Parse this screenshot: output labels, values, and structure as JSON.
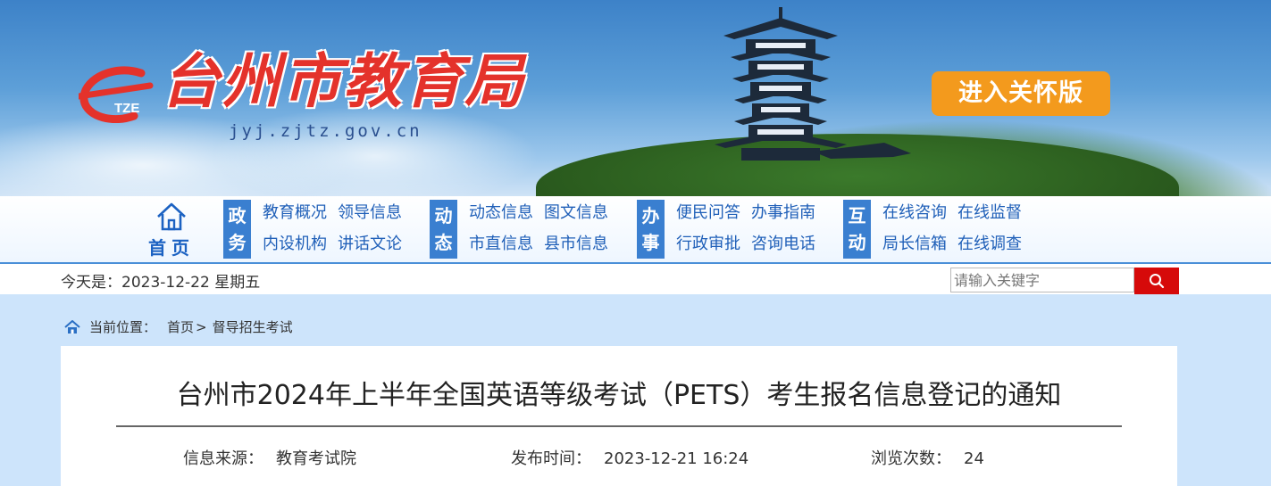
{
  "header": {
    "logo_text": "台州市教育局",
    "logo_mark": "TZE",
    "url": "jyj.zjtz.gov.cn",
    "care_button": "进入关怀版"
  },
  "nav": {
    "home_label": "首页",
    "groups": [
      {
        "category": [
          "政",
          "务"
        ],
        "links": [
          "教育概况",
          "领导信息",
          "内设机构",
          "讲话文论"
        ]
      },
      {
        "category": [
          "动",
          "态"
        ],
        "links": [
          "动态信息",
          "图文信息",
          "市直信息",
          "县市信息"
        ]
      },
      {
        "category": [
          "办",
          "事"
        ],
        "links": [
          "便民问答",
          "办事指南",
          "行政审批",
          "咨询电话"
        ]
      },
      {
        "category": [
          "互",
          "动"
        ],
        "links": [
          "在线咨询",
          "在线监督",
          "局长信箱",
          "在线调查"
        ]
      }
    ]
  },
  "datebar": {
    "date_text": "今天是：2023-12-22 星期五",
    "search_placeholder": "请输入关键字"
  },
  "breadcrumb": {
    "label": "当前位置：",
    "home": "首页",
    "sep": ">",
    "current": "督导招生考试"
  },
  "article": {
    "title": "台州市2024年上半年全国英语等级考试（PETS）考生报名信息登记的通知",
    "source_label": "信息来源：",
    "source_value": "教育考试院",
    "time_label": "发布时间：",
    "time_value": "2023-12-21 16:24",
    "views_label": "浏览次数：",
    "views_value": "24"
  },
  "colors": {
    "nav_blue": "#3a7fd0",
    "link_blue": "#1f5fb8",
    "care_orange": "#f39a1d",
    "search_red": "#d60a0a",
    "logo_red": "#e4322b"
  }
}
